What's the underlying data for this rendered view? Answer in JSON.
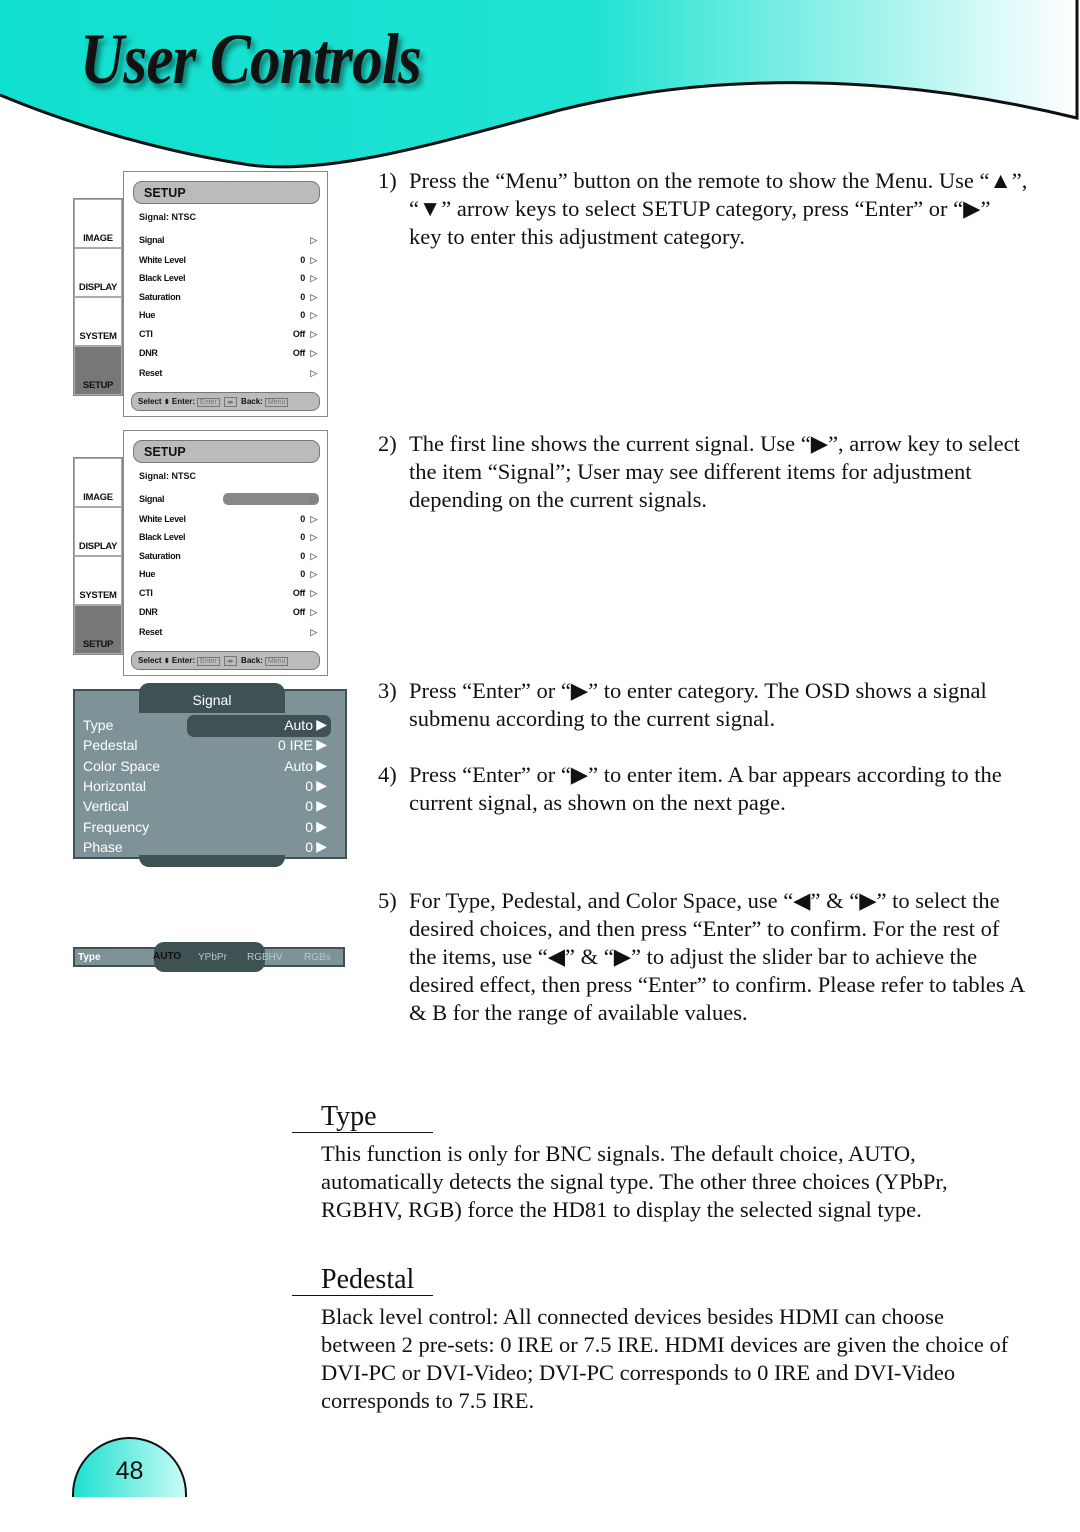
{
  "header": {
    "title": "User Controls",
    "gradient": [
      "#10e0cf",
      "#ffffff"
    ]
  },
  "steps": [
    {
      "num": "1)",
      "text": "Press the “Menu” button on the remote to show the Menu. Use “▲”, “▼” arrow keys to select SETUP category, press “Enter” or “▶” key to enter this adjustment category."
    },
    {
      "num": "2)",
      "text": "The first line shows the current signal. Use “▶”, arrow key to select the item “Signal”; User may see different items for adjustment depending on the current signals."
    },
    {
      "num": "3)",
      "text": "Press “Enter” or “▶” to enter category.  The OSD shows a signal submenu according to the current signal."
    },
    {
      "num": "4)",
      "text": "Press “Enter” or “▶” to enter item.  A bar appears according to the current signal, as shown on the next page."
    },
    {
      "num": "5)",
      "text": "For Type, Pedestal, and Color Space, use “◀” & “▶” to select the desired choices, and then press “Enter” to confirm.  For the rest of the items, use “◀” & “▶” to adjust the slider bar to achieve the desired effect, then press “Enter” to confirm.  Please refer to tables A & B for the range of available values."
    }
  ],
  "osd": {
    "tabs": [
      "IMAGE",
      "DISPLAY",
      "SYSTEM",
      "SETUP"
    ],
    "title": "SETUP",
    "signal": "Signal: NTSC",
    "rows": [
      {
        "label": "Signal",
        "value": ""
      },
      {
        "label": "White Level",
        "value": "0"
      },
      {
        "label": "Black Level",
        "value": "0"
      },
      {
        "label": "Saturation",
        "value": "0"
      },
      {
        "label": "Hue",
        "value": "0"
      },
      {
        "label": "CTI",
        "value": "Off"
      },
      {
        "label": "DNR",
        "value": "Off"
      },
      {
        "label": "Reset",
        "value": ""
      }
    ],
    "footer": {
      "select": "Select",
      "enter": "Enter:",
      "enter_key": "Enter",
      "back": "Back:",
      "back_key": "Menu"
    }
  },
  "signal_menu": {
    "title": "Signal",
    "rows": [
      {
        "label": "Type",
        "value": "Auto"
      },
      {
        "label": "Pedestal",
        "value": "0 IRE"
      },
      {
        "label": "Color Space",
        "value": "Auto"
      },
      {
        "label": "Horizontal",
        "value": "0"
      },
      {
        "label": "Vertical",
        "value": "0"
      },
      {
        "label": "Frequency",
        "value": "0"
      },
      {
        "label": "Phase",
        "value": "0"
      }
    ],
    "colors": {
      "panel": "#7e9397",
      "dark": "#3e5254"
    }
  },
  "type_bar": {
    "label": "Type",
    "options": [
      "AUTO",
      "YPbPr",
      "RGBHV",
      "RGBs"
    ],
    "selected": "AUTO"
  },
  "sections": [
    {
      "title": "Type",
      "text": "This function is only for BNC signals.  The default choice, AUTO, automatically detects the signal type.  The other three choices (YPbPr, RGBHV, RGB) force the HD81 to display the selected signal type."
    },
    {
      "title": "Pedestal",
      "text": "Black level control: All connected devices besides HDMI can choose between 2 pre-sets: 0 IRE or 7.5 IRE.  HDMI devices are given the choice of DVI-PC or DVI-Video; DVI-PC corresponds to 0 IRE and DVI-Video corresponds to 7.5 IRE."
    }
  ],
  "page_number": "48"
}
